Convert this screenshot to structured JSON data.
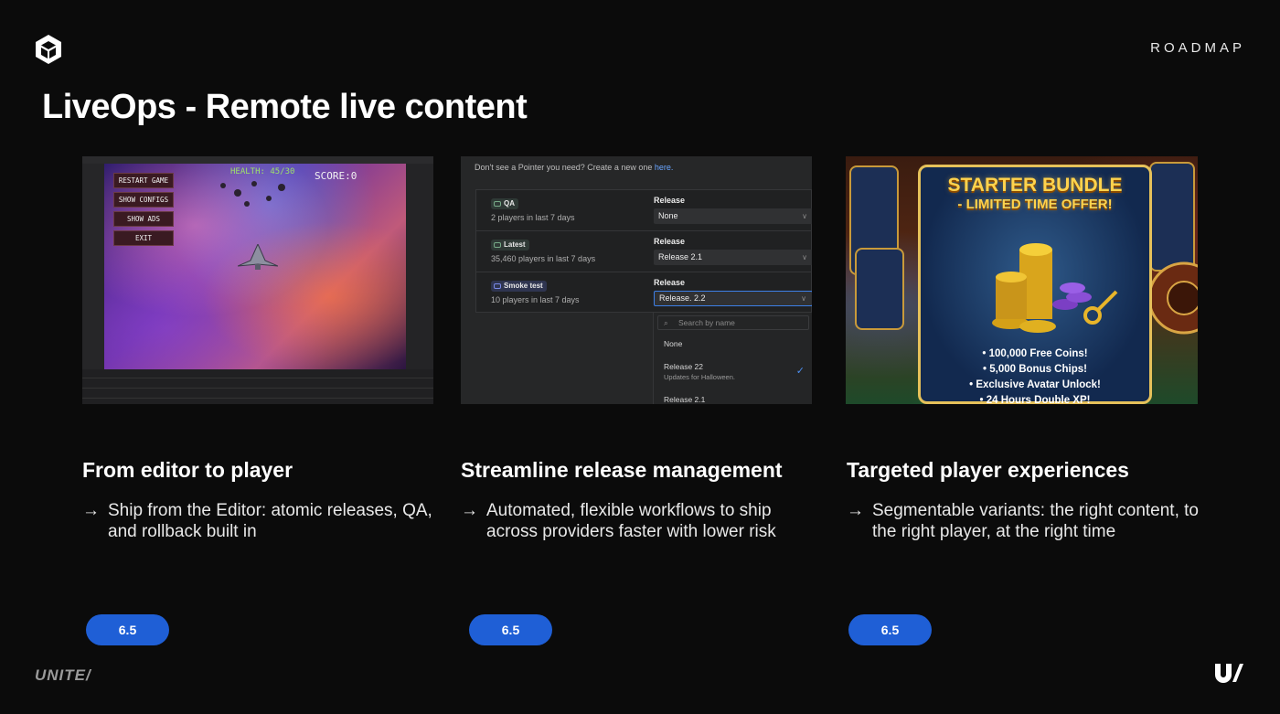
{
  "header": {
    "section": "ROADMAP",
    "title": "LiveOps - Remote live content"
  },
  "columns": [
    {
      "heading": "From editor to player",
      "arrow": "→",
      "text": "Ship from the Editor: atomic releases, QA, and rollback built in",
      "version": "6.5"
    },
    {
      "heading": "Streamline release management",
      "arrow": "→",
      "text": "Automated, flexible workflows to ship across providers faster with lower risk",
      "version": "6.5"
    },
    {
      "heading": "Targeted player experiences",
      "arrow": "→",
      "text": "Segmentable variants: the right content, to the right player, at the right time",
      "version": "6.5"
    }
  ],
  "shot_game": {
    "health": "HEALTH: 45/30",
    "score": "SCORE:0",
    "menu": [
      "RESTART GAME",
      "SHOW CONFIGS",
      "SHOW ADS",
      "EXIT"
    ]
  },
  "shot_release": {
    "prompt": "Don't see a Pointer you need? Create a new one ",
    "prompt_link": "here.",
    "release_label": "Release",
    "rows": [
      {
        "badge": "QA",
        "players": "2 players in last 7 days",
        "selected": "None"
      },
      {
        "badge": "Latest",
        "players": "35,460 players in last 7 days",
        "selected": "Release 2.1"
      },
      {
        "badge": "Smoke test",
        "players": "10 players in last 7 days",
        "selected": "Release. 2.2"
      }
    ],
    "search_placeholder": "Search by name",
    "options": [
      "None",
      "Release 22",
      "Release 2.1"
    ],
    "option_note": "Updates for Halloween."
  },
  "shot_bundle": {
    "title_line1": "STARTER BUNDLE",
    "title_line2": "- LIMITED TIME OFFER!",
    "bullets": [
      "• 100,000 Free Coins!",
      "• 5,000 Bonus Chips!",
      "• Exclusive Avatar Unlock!",
      "• 24 Hours Double XP!"
    ]
  },
  "footer": {
    "event": "UNITE/"
  },
  "colors": {
    "accent": "#1f5fd6",
    "background": "#0b0b0b"
  }
}
